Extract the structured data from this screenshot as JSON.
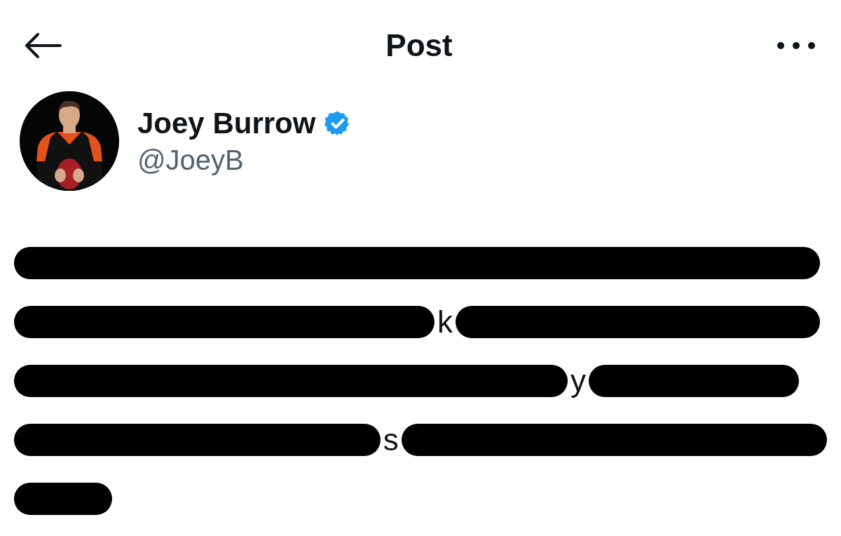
{
  "header": {
    "title": "Post"
  },
  "author": {
    "name": "Joey Burrow",
    "verified": true,
    "handle": "@JoeyB"
  },
  "body_lines": [
    {
      "kind": "redacted"
    },
    {
      "kind": "partial",
      "visible": "k"
    },
    {
      "kind": "partial",
      "visible": "y"
    },
    {
      "kind": "partial",
      "visible": "s"
    },
    {
      "kind": "short"
    }
  ]
}
